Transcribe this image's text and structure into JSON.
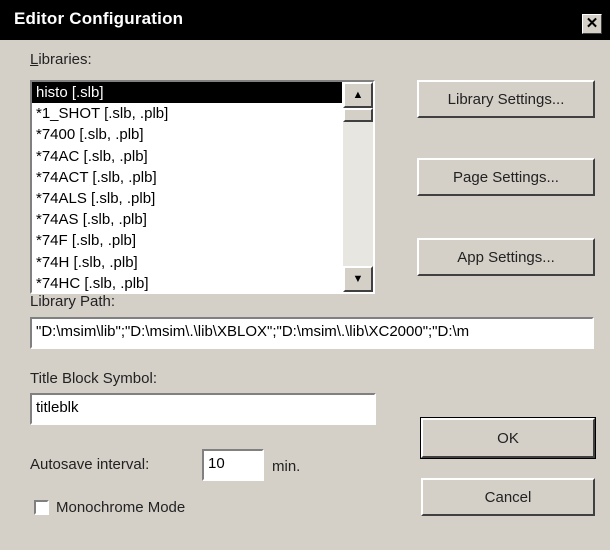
{
  "window": {
    "title": "Editor Configuration",
    "close_glyph": "✕",
    "close_icon": "close-icon"
  },
  "libraries": {
    "label": "Libraries:",
    "label_hotkey": "L",
    "items": [
      "histo [.slb]",
      "*1_SHOT [.slb, .plb]",
      "*7400 [.slb, .plb]",
      "*74AC [.slb, .plb]",
      "*74ACT [.slb, .plb]",
      "*74ALS [.slb, .plb]",
      "*74AS [.slb, .plb]",
      "*74F [.slb, .plb]",
      "*74H [.slb, .plb]",
      "*74HC [.slb, .plb]"
    ],
    "selected_index": 0,
    "scroll_up_icon": "arrow-up-icon",
    "scroll_down_icon": "arrow-down-icon"
  },
  "library_path": {
    "label": "Library Path:",
    "value": "\"D:\\msim\\lib\";\"D:\\msim\\.\\lib\\XBLOX\";\"D:\\msim\\.\\lib\\XC2000\";\"D:\\m"
  },
  "title_block": {
    "label": "Title Block Symbol:",
    "value": "titleblk"
  },
  "autosave": {
    "label": "Autosave interval:",
    "value": "10",
    "unit": "min."
  },
  "monochrome": {
    "label": "Monochrome Mode",
    "checked": false
  },
  "buttons": {
    "library_settings": "Library Settings...",
    "page_settings": "Page Settings...",
    "app_settings": "App Settings...",
    "ok": "OK",
    "cancel": "Cancel"
  }
}
